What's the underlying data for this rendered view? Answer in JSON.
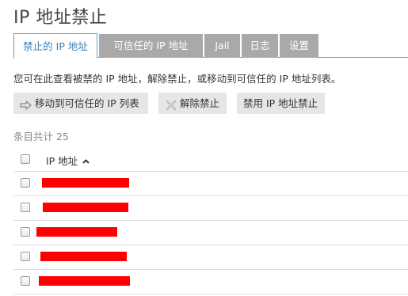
{
  "page_title": "IP 地址禁止",
  "tabs": [
    {
      "label": "禁止的 IP 地址",
      "active": true
    },
    {
      "label": "可信任的 IP 地址",
      "active": false
    },
    {
      "label": "Jail",
      "active": false
    },
    {
      "label": "日志",
      "active": false
    },
    {
      "label": "设置",
      "active": false
    }
  ],
  "description": "您可在此查看被禁的 IP 地址，解除禁止，或移动到可信任的 IP 地址列表。",
  "toolbar": {
    "move_label": "移动到可信任的 IP 列表",
    "unban_label": "解除禁止",
    "disable_label": "禁用 IP 地址禁止",
    "move_icon": "arrow-right-icon",
    "unban_icon": "x-icon"
  },
  "table": {
    "count_label": "条目共计 25",
    "column_ip": "IP 地址",
    "sort_icon": "caret-up-icon",
    "rows": [
      {
        "ip": "",
        "redacted": true
      },
      {
        "ip": "",
        "redacted": true
      },
      {
        "ip": "",
        "redacted": true
      },
      {
        "ip": "",
        "redacted": true
      },
      {
        "ip": "",
        "redacted": true
      }
    ]
  },
  "colors": {
    "accent": "#3a7fb3",
    "tab_inactive": "#a9a9a9",
    "button_bg": "#e6e6e6",
    "redaction": "#ff0000"
  }
}
